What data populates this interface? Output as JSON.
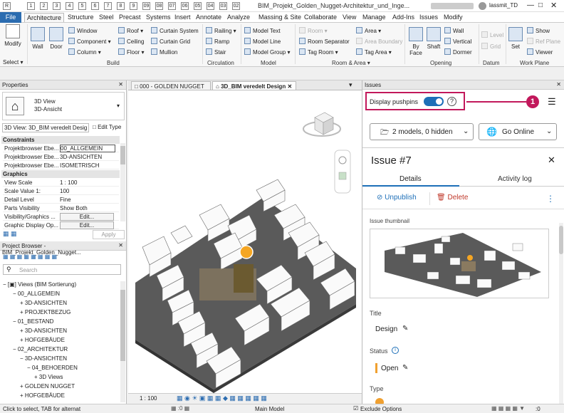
{
  "titlebar": {
    "title": "BIM_Projekt_Golden_Nugget-Architektur_und_Inge...",
    "user": "lassmit_TD"
  },
  "qat_keys": [
    "1",
    "2",
    "3",
    "4",
    "5",
    "6",
    "7",
    "8",
    "9",
    "09",
    "08",
    "07",
    "06",
    "05",
    "04",
    "03",
    "02"
  ],
  "tabs": [
    "File",
    "Architecture",
    "Structure",
    "Steel",
    "Precast",
    "Systems",
    "Insert",
    "Annotate",
    "Analyze",
    "Massing & Site",
    "Collaborate",
    "View",
    "Manage",
    "Add-Ins",
    "Issues",
    "Modify"
  ],
  "ribbon": {
    "modify": "Modify",
    "select": "Select ▾",
    "wall": "Wall",
    "door": "Door",
    "window": "Window",
    "component": "Component ▾",
    "column": "Column ▾",
    "roof": "Roof ▾",
    "ceiling": "Ceiling",
    "floor": "Floor ▾",
    "curtain_system": "Curtain System",
    "curtain_grid": "Curtain Grid",
    "mullion": "Mullion",
    "railing": "Railing ▾",
    "ramp": "Ramp",
    "stair": "Stair",
    "model_text": "Model Text",
    "model_line": "Model Line",
    "model_group": "Model Group ▾",
    "room": "Room ▾",
    "room_separator": "Room Separator",
    "tag_room": "Tag Room ▾",
    "area": "Area ▾",
    "area_boundary": "Area Boundary",
    "tag_area": "Tag Area ▾",
    "by_face": "By Face",
    "shaft": "Shaft",
    "wall_o": "Wall",
    "vertical": "Vertical",
    "dormer": "Dormer",
    "level": "Level",
    "grid": "Grid",
    "set": "Set",
    "show": "Show",
    "ref_plane": "Ref Plane",
    "viewer": "Viewer",
    "panels": [
      "Build",
      "Circulation",
      "Model",
      "Room & Area ▾",
      "Opening",
      "Datum",
      "Work Plane"
    ]
  },
  "viewtabs": [
    "000 - GOLDEN NUGGET",
    "3D_BIM veredelt Design"
  ],
  "properties": {
    "title": "Properties",
    "type_line1": "3D View",
    "type_line2": "3D-Ansicht",
    "selector": "3D View: 3D_BIM veredelt Desig",
    "edit_type": "Edit Type",
    "constraints": "Constraints",
    "graphics": "Graphics",
    "rows_constraints": [
      {
        "k": "Projektbrowser Ebe...",
        "v": "00_ALLGEMEIN"
      },
      {
        "k": "Projektbrowser Ebe...",
        "v": "3D-ANSICHTEN"
      },
      {
        "k": "Projektbrowser Ebe...",
        "v": "ISOMETRISCH"
      }
    ],
    "rows_graphics": [
      {
        "k": "View Scale",
        "v": "1 : 100"
      },
      {
        "k": "Scale Value  1:",
        "v": "100"
      },
      {
        "k": "Detail Level",
        "v": "Fine"
      },
      {
        "k": "Parts Visibility",
        "v": "Show Both"
      },
      {
        "k": "Visibility/Graphics ...",
        "v": "Edit..."
      },
      {
        "k": "Graphic Display Op...",
        "v": "Edit..."
      }
    ],
    "apply": "Apply"
  },
  "browser": {
    "title": "Project Browser - BIM_Projekt_Golden_Nugget...",
    "search": "Search",
    "items": [
      {
        "t": "− [▣] Views (BIM Sortierung)",
        "x": 4
      },
      {
        "t": "− 00_ALLGEMEIN",
        "x": 18
      },
      {
        "t": "+ 3D-ANSICHTEN",
        "x": 28
      },
      {
        "t": "+ PROJEKTBEZUG",
        "x": 28
      },
      {
        "t": "− 01_BESTAND",
        "x": 18
      },
      {
        "t": "+ 3D-ANSICHTEN",
        "x": 28
      },
      {
        "t": "+ HOFGEBÄUDE",
        "x": 28
      },
      {
        "t": "− 02_ARCHITEKTUR",
        "x": 18
      },
      {
        "t": "− 3D-ANSICHTEN",
        "x": 28
      },
      {
        "t": "− 04_BEHOERDEN",
        "x": 38
      },
      {
        "t": "+ 3D Views",
        "x": 48
      },
      {
        "t": "+ GOLDEN NUGGET",
        "x": 28
      },
      {
        "t": "+ HOFGEBÄUDE",
        "x": 28
      }
    ]
  },
  "viewctrl": {
    "scale": "1 : 100"
  },
  "issues": {
    "title": "Issues",
    "pushpins_label": "Display pushpins",
    "pushpins_on": true,
    "callout": "1",
    "models": "2 models, 0 hidden",
    "go_online": "Go Online",
    "issue_title": "Issue #7",
    "tab_details": "Details",
    "tab_activity": "Activity log",
    "unpublish": "Unpublish",
    "delete": "Delete",
    "thumb_label": "Issue thumbnail",
    "title_label": "Title",
    "title_value": "Design",
    "status_label": "Status",
    "status_value": "Open",
    "type_label": "Type",
    "colors": {
      "accent": "#1d6fb8",
      "callout": "#c2185b",
      "status": "#f0a030",
      "delete": "#c0392b"
    }
  },
  "statusbar": {
    "hint": "Click to select, TAB for alternat",
    "model": "Main Model",
    "exclude": "Exclude Options",
    "zero": ":0"
  }
}
